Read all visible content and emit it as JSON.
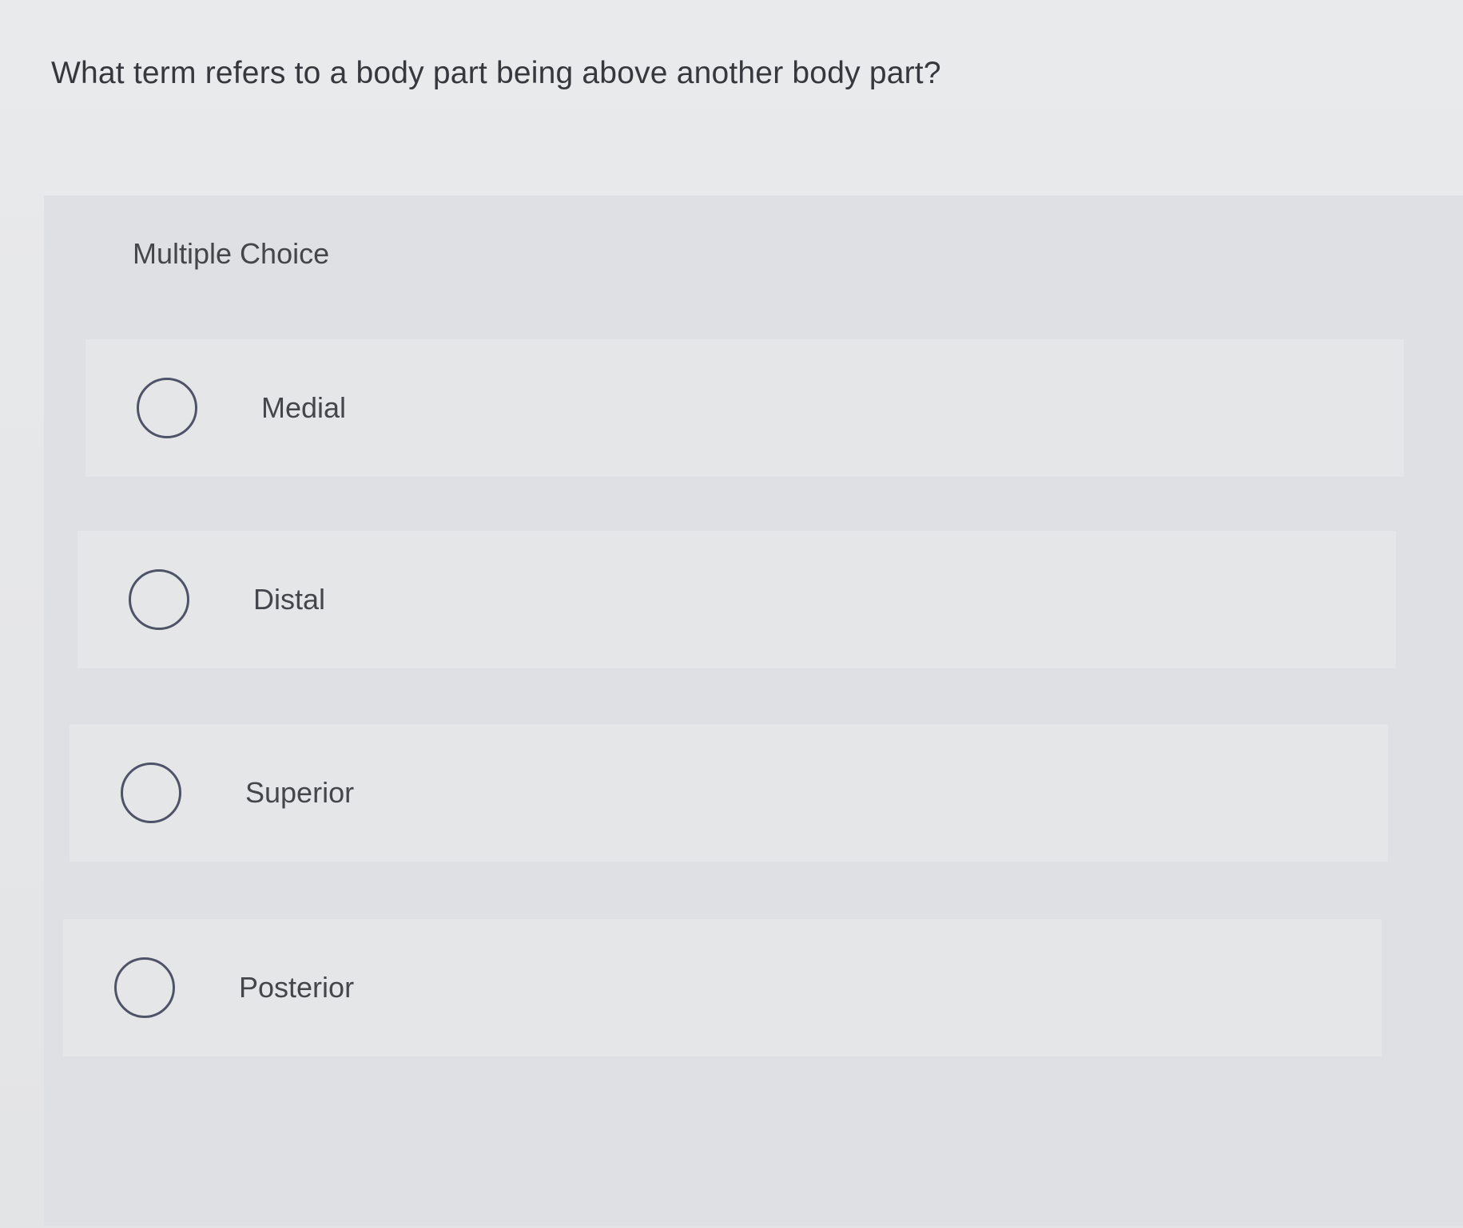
{
  "question": {
    "text": "What term refers to a body part being above another body part?"
  },
  "multiple_choice": {
    "label": "Multiple Choice",
    "options": [
      {
        "label": "Medial",
        "selected": false
      },
      {
        "label": "Distal",
        "selected": false
      },
      {
        "label": "Superior",
        "selected": false
      },
      {
        "label": "Posterior",
        "selected": false
      }
    ]
  },
  "colors": {
    "background": "#e6e7e9",
    "panel": "#dfe0e3",
    "option_row": "#e5e6e8",
    "radio_border": "#4f5368",
    "text": "#35383d"
  }
}
